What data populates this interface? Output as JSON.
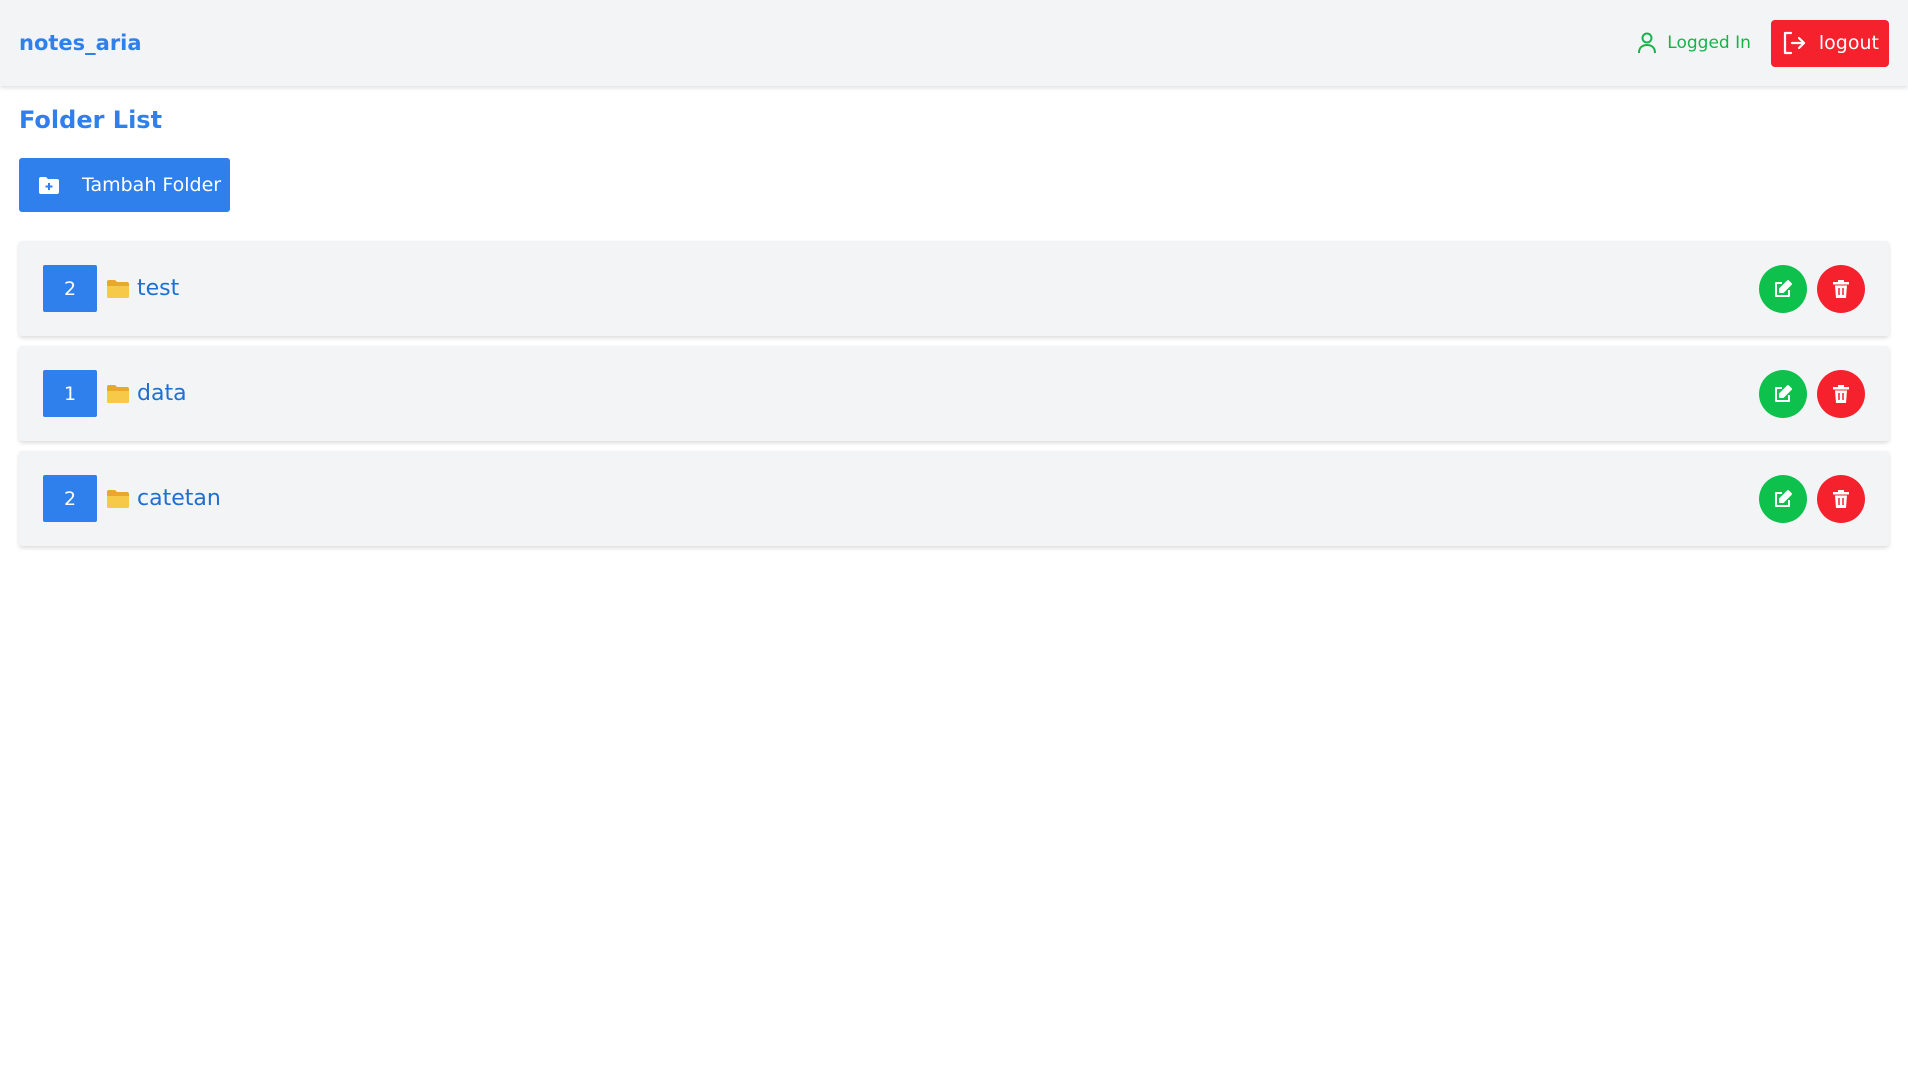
{
  "app": {
    "brand": "notes_aria"
  },
  "header": {
    "status_text": "Logged In",
    "logout_label": "logout"
  },
  "page": {
    "title": "Folder List",
    "add_button_label": "Tambah Folder"
  },
  "folders": [
    {
      "count": "2",
      "name": "test"
    },
    {
      "count": "1",
      "name": "data"
    },
    {
      "count": "2",
      "name": "catetan"
    }
  ],
  "icons": {
    "user": "user-icon",
    "logout": "logout-icon",
    "folder_plus": "folder-plus-icon",
    "folder": "folder-icon",
    "edit": "edit-icon",
    "delete": "trash-icon"
  },
  "colors": {
    "primary": "#2f80ed",
    "success": "#0ec14c",
    "danger": "#f5222d",
    "background": "#f3f4f6"
  }
}
